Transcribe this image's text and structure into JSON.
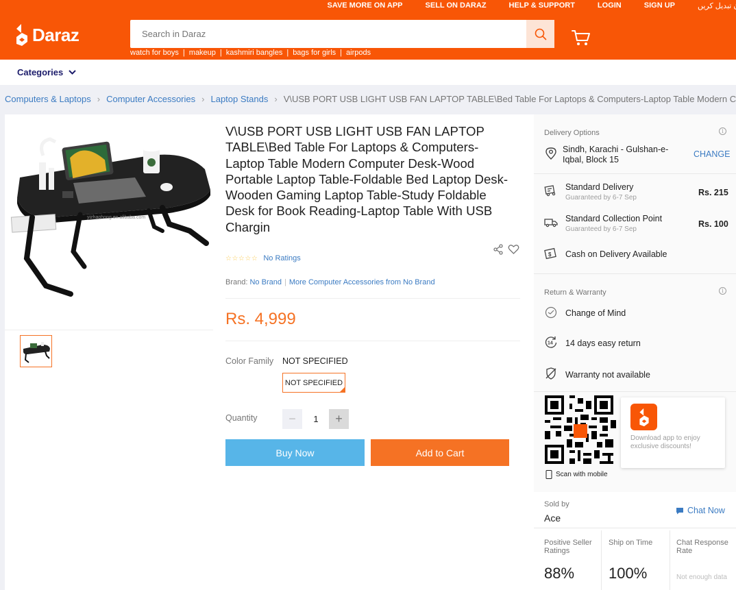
{
  "header": {
    "top_links": [
      "SAVE MORE ON APP",
      "SELL ON DARAZ",
      "HELP & SUPPORT",
      "LOGIN",
      "SIGN UP"
    ],
    "language_link": "زبان تبدیل کریں",
    "logo_text": "Daraz",
    "search_placeholder": "Search in Daraz",
    "suggestions": [
      "watch for boys",
      "makeup",
      "kashmiri bangles",
      "bags for girls",
      "airpods"
    ],
    "brand_color": "#f85606"
  },
  "categories_label": "Categories",
  "breadcrumb": {
    "items": [
      "Computers & Laptops",
      "Computer Accessories",
      "Laptop Stands"
    ],
    "current": "V\\USB PORT USB LIGHT USB FAN LAPTOP TABLE\\Bed Table For Laptops & Computers-Laptop Table Modern Computer"
  },
  "product": {
    "title": "V\\USB PORT USB LIGHT USB FAN LAPTOP TABLE\\Bed Table For Laptops & Computers-Laptop Table Modern Computer Desk-Wood Portable Laptop Table-Foldable Bed Laptop Desk-Wooden Gaming Laptop Table-Study Foldable Desk for Book Reading-Laptop Table With USB Chargin",
    "image_watermark": "yizhaohong.en.alibaba.com",
    "ratings_text": "No Ratings",
    "stars": "☆☆☆☆☆",
    "brand_label": "Brand:",
    "brand_value": "No Brand",
    "more_from": "More Computer Accessories from No Brand",
    "price": "Rs. 4,999",
    "color_family_label": "Color Family",
    "color_family_value": "NOT SPECIFIED",
    "color_option": "NOT SPECIFIED",
    "quantity_label": "Quantity",
    "quantity": "1",
    "minus": "−",
    "plus": "+",
    "buy_now": "Buy Now",
    "add_to_cart": "Add to Cart",
    "accent_color": "#f57224",
    "buy_color": "#57b5e8"
  },
  "delivery": {
    "title": "Delivery Options",
    "location": [
      "Sindh, Karachi - Gulshan-e-",
      "Iqbal, Block 15"
    ],
    "change": "CHANGE",
    "options": [
      {
        "name": "Standard Delivery",
        "sub": "Guaranteed by 6-7 Sep",
        "price": "Rs. 215"
      },
      {
        "name": "Standard Collection Point",
        "sub": "Guaranteed by 6-7 Sep",
        "price": "Rs. 100"
      }
    ],
    "cod": "Cash on Delivery Available"
  },
  "return_warranty": {
    "title": "Return & Warranty",
    "items": [
      "Change of Mind",
      "14 days easy return",
      "Warranty not available"
    ]
  },
  "app_promo": {
    "scan_text": "Scan with mobile",
    "download_text": "Download app to enjoy exclusive discounts!"
  },
  "seller": {
    "label": "Sold by",
    "name": "Ace",
    "chat": "Chat Now",
    "metrics": [
      {
        "label": "Positive Seller Ratings",
        "value": "88%"
      },
      {
        "label": "Ship on Time",
        "value": "100%"
      },
      {
        "label": "Chat Response Rate",
        "value": "",
        "note": "Not enough data"
      }
    ]
  }
}
